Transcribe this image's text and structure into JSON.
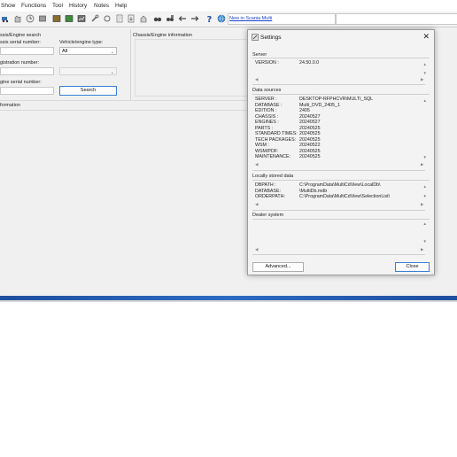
{
  "menu": [
    "Show",
    "Functions",
    "Tool",
    "History",
    "Notes",
    "Help"
  ],
  "toolbar": {
    "news_link": "New in Scania Multi"
  },
  "search_panel": {
    "title": "ssis/Engine search",
    "chassis_label": "ssis serial number:",
    "vehicle_engine_type_label": "Vehicle/engine type:",
    "vehicle_engine_type_value": "All",
    "registration_label": "gistration number:",
    "engine_label": "gine serial number:",
    "search_button": "Search"
  },
  "info_panel": {
    "title": "Chassis/Engine information"
  },
  "bottom_tab": {
    "label": "formation"
  },
  "settings_dialog": {
    "title": "Settings",
    "server": {
      "label": "Server",
      "rows": [
        {
          "key": "VERSION :",
          "value": "24.50.0.0"
        }
      ]
    },
    "data_sources": {
      "label": "Data sources",
      "rows": [
        {
          "key": "SERVER :",
          "value": "DESKTOP-RFPHCVR\\MULTI_SQL"
        },
        {
          "key": "DATABASE :",
          "value": "Multi_DVD_2405_1"
        },
        {
          "key": "EDITION :",
          "value": "2405"
        },
        {
          "key": "CHASSIS :",
          "value": "20240527"
        },
        {
          "key": "ENGINES :",
          "value": "20240527"
        },
        {
          "key": "PARTS :",
          "value": "20240525"
        },
        {
          "key": "STANDARD TIMES:",
          "value": "20240525"
        },
        {
          "key": "TECH PACKAGES:",
          "value": "20240525"
        },
        {
          "key": "WSM :",
          "value": "20240522"
        },
        {
          "key": "WSM/PDF:",
          "value": "20240525"
        },
        {
          "key": "MAINTENANCE:",
          "value": "20240525"
        }
      ]
    },
    "locally_stored": {
      "label": "Locally stored data",
      "rows": [
        {
          "key": "DBPATH :",
          "value": "C:\\ProgramData\\MultiCdView\\LocalDb\\"
        },
        {
          "key": "DATABASE:",
          "value": "\\MultiDb.mdb"
        },
        {
          "key": "ORDERPATH:",
          "value": "C:\\ProgramData\\MultiCdView\\SelectionList\\"
        }
      ]
    },
    "dealer_system": {
      "label": "Dealer system"
    },
    "advanced_button": "Advanced...",
    "close_button": "Close"
  },
  "colors": {
    "accent": "#3b7fd6",
    "link": "#1a3ecc",
    "taskbar_stripe": "#1f4f9e"
  }
}
